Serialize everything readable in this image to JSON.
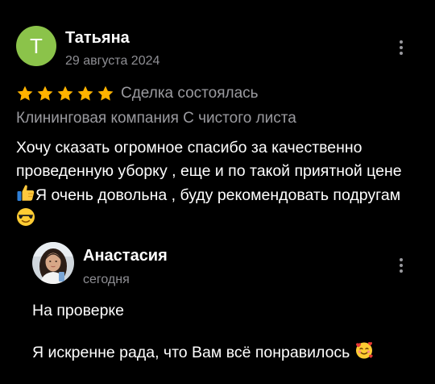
{
  "review": {
    "avatar_letter": "Т",
    "avatar_color": "#8bc34a",
    "author": "Татьяна",
    "date": "29 августа 2024",
    "rating": 5,
    "rating_max": 5,
    "star_color": "#ffb300",
    "status": "Сделка состоялась",
    "company": "Клининговая компания С чистого листа",
    "text_part1": "Хочу сказать огромное спасибо за качественно проведенную уборку , еще и по такой приятной цене ",
    "text_part2": "Я очень довольна , буду рекомендовать подругам ",
    "emoji_1": "thumbs-up-icon",
    "emoji_2": "sunglasses-face-icon",
    "menu_icon": "more-vertical-icon"
  },
  "reply": {
    "author": "Анастасия",
    "date": "сегодня",
    "status": "На проверке",
    "text": "Я искренне рада, что Вам всё понравилось ",
    "emoji": "smiling-face-with-hearts-icon",
    "menu_icon": "more-vertical-icon"
  }
}
